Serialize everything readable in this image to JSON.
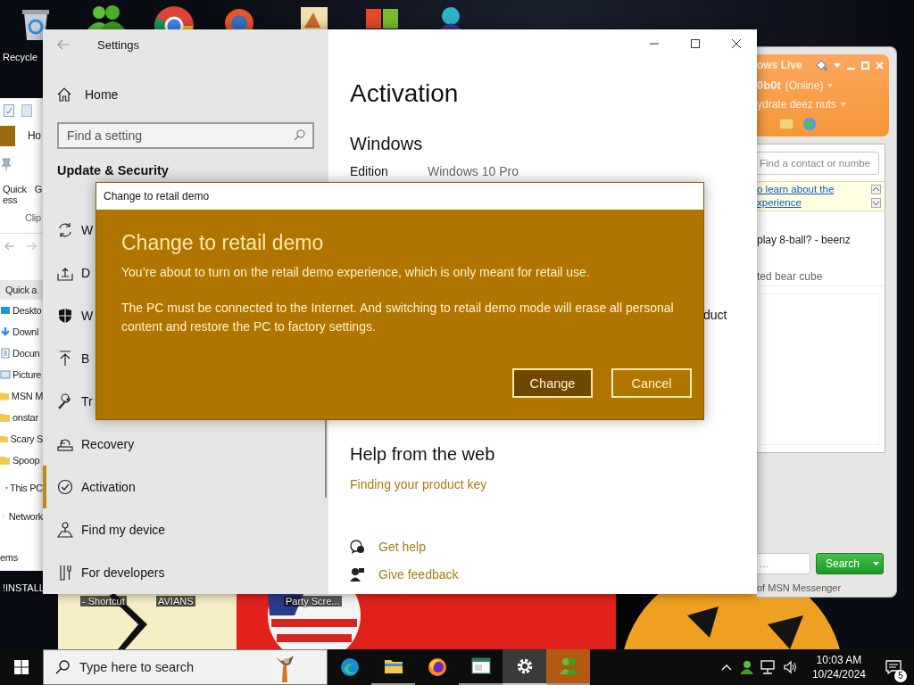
{
  "desktop": {
    "recycle_label": "Recycle",
    "bottom_labels": [
      {
        "label": "!INSTALL"
      },
      {
        "label": "- Shortcut"
      },
      {
        "label": "AVIANS"
      },
      {
        "label": "Party Scre..."
      }
    ]
  },
  "explorer": {
    "ribbon_tab": "Ho",
    "ribbon_labels": [
      "Quick",
      "ess",
      "G",
      "Clip"
    ],
    "nav_header": "Quick a",
    "items": [
      {
        "label": "Deskto",
        "kind": "desktop"
      },
      {
        "label": "Downl",
        "kind": "download"
      },
      {
        "label": "Docun",
        "kind": "document"
      },
      {
        "label": "Picture",
        "kind": "picture"
      },
      {
        "label": "MSN M",
        "kind": "folder"
      },
      {
        "label": "onstar",
        "kind": "folder"
      },
      {
        "label": "Scary S",
        "kind": "folder"
      },
      {
        "label": "Spoop",
        "kind": "folder"
      },
      {
        "label": "This PC",
        "kind": "pc"
      },
      {
        "label": "Network",
        "kind": "network"
      }
    ],
    "status": "ems"
  },
  "settings": {
    "title": "Settings",
    "home": "Home",
    "search": {
      "placeholder": "Find a setting"
    },
    "section": "Update & Security",
    "nav": [
      {
        "label": "W",
        "kind": "sync",
        "selected": false
      },
      {
        "label": "D",
        "kind": "delivery",
        "selected": false
      },
      {
        "label": "W",
        "kind": "shield",
        "selected": false
      },
      {
        "label": "B",
        "kind": "backup",
        "selected": false
      },
      {
        "label": "Tr",
        "kind": "wrench",
        "selected": false
      },
      {
        "label": "Recovery",
        "kind": "recovery",
        "selected": false
      },
      {
        "label": "Activation",
        "kind": "check",
        "selected": true
      },
      {
        "label": "Find my device",
        "kind": "locate",
        "selected": false
      },
      {
        "label": "For developers",
        "kind": "tools",
        "selected": false
      }
    ],
    "content": {
      "title": "Activation",
      "subtitle": "Windows",
      "edition_label": "Edition",
      "edition_value": "Windows 10 Pro",
      "product_fragment": "duct",
      "help_title": "Help from the web",
      "help_link": "Finding your product key",
      "actions": [
        {
          "label": "Get help",
          "kind": "help"
        },
        {
          "label": "Give feedback",
          "kind": "feedback"
        }
      ]
    }
  },
  "dialog": {
    "window_title": "Change to retail demo",
    "heading": "Change to retail demo",
    "paragraphs": [
      "You’re about to turn on the retail demo experience, which is only meant for retail use.",
      "The PC must be connected to the Internet. And switching to retail demo mode will erase all personal content and restore the PC to factory settings."
    ],
    "buttons": [
      {
        "label": "Change",
        "default": true
      },
      {
        "label": "Cancel",
        "default": false
      }
    ]
  },
  "messenger": {
    "header_title": "ows Live",
    "user": "0b0t",
    "status": "(Online)",
    "personal_message": "ydrate deez nuts",
    "search": {
      "placeholder": "Find a contact or numbe"
    },
    "banner_links": [
      "o learn about the",
      "xperience"
    ],
    "entries": [
      "play 8-ball? - beenz",
      "ted bear cube"
    ],
    "bottom_search": {
      "placeholder": "..."
    },
    "search_button": "Search",
    "footer": "of MSN Messenger"
  },
  "taskbar": {
    "search": {
      "placeholder": "Type here to search"
    },
    "apps": [
      {
        "kind": "edge",
        "active": false,
        "running": false
      },
      {
        "kind": "folder",
        "active": false,
        "running": true
      },
      {
        "kind": "firefox",
        "active": false,
        "running": false
      },
      {
        "kind": "app",
        "active": false,
        "running": true
      },
      {
        "kind": "settings",
        "active": true,
        "running": true
      },
      {
        "kind": "messenger",
        "active": false,
        "flashing": true,
        "running": true
      }
    ],
    "time": "10:03 AM",
    "date": "10/24/2024",
    "notifications": "5"
  }
}
